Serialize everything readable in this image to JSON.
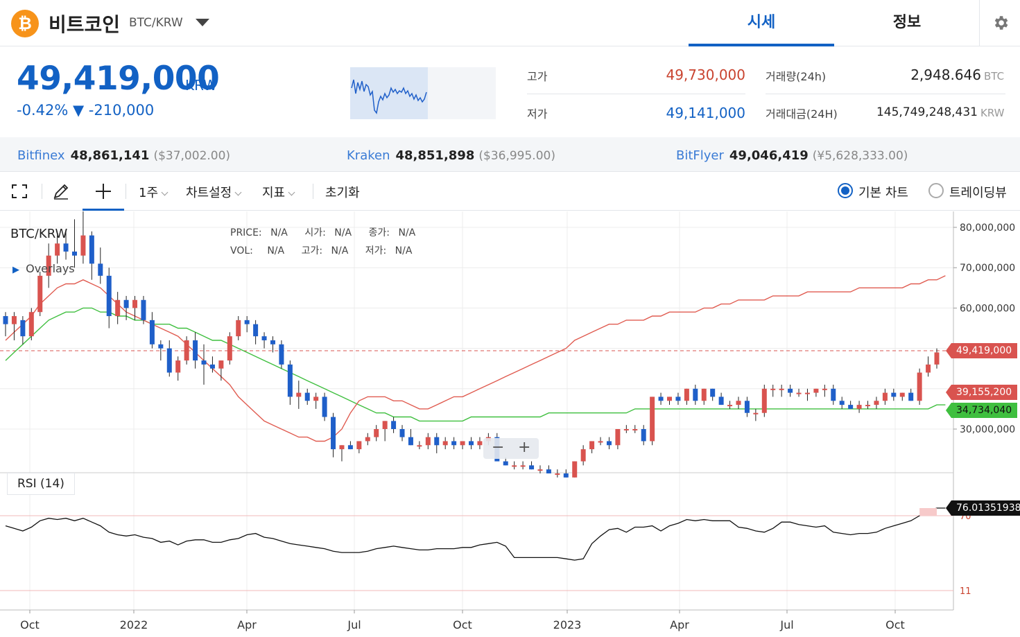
{
  "header": {
    "coin_icon_glyph": "₿",
    "coin_name": "비트코인",
    "pair": "BTC/KRW",
    "tabs": [
      {
        "label": "시세",
        "active": true
      },
      {
        "label": "정보",
        "active": false
      }
    ]
  },
  "summary": {
    "price": "49,419,000",
    "unit": "KRW",
    "change": "-0.42% ▼ -210,000",
    "high_label": "고가",
    "high_value": "49,730,000",
    "low_label": "저가",
    "low_value": "49,141,000",
    "volume_label": "거래량(24h)",
    "volume_value": "2,948.646",
    "volume_unit": "BTC",
    "amount_label": "거래대금(24H)",
    "amount_value": "145,749,248,431",
    "amount_unit": "KRW"
  },
  "exchanges": [
    {
      "name": "Bitfinex",
      "price": "48,861,141",
      "fx": "($37,002.00)"
    },
    {
      "name": "Kraken",
      "price": "48,851,898",
      "fx": "($36,995.00)"
    },
    {
      "name": "BitFlyer",
      "price": "49,046,419",
      "fx": "(¥5,628,333.00)"
    }
  ],
  "toolbar": {
    "interval": "1주",
    "chart_settings": "차트설정",
    "indicators": "지표",
    "reset": "초기화",
    "basic_chart": "기본 차트",
    "tradingview": "트레이딩뷰"
  },
  "chart": {
    "symbol": "BTC/KRW",
    "overlays": "Overlays",
    "info_labels": [
      "PRICE:",
      "N/A",
      "시가:",
      "N/A",
      "종가:",
      "N/A",
      "VOL:",
      "N/A",
      "고가:",
      "N/A",
      "저가:",
      "N/A"
    ],
    "y_ticks": [
      "80,000,000",
      "70,000,000",
      "60,000,000",
      "30,000,000"
    ],
    "x_ticks": [
      "Oct",
      "2022",
      "Apr",
      "Jul",
      "Oct",
      "2023",
      "Apr",
      "Jul",
      "Oct"
    ],
    "tags": {
      "last": "49,419,000",
      "ma1": "39,155,200",
      "ma2": "34,734,040",
      "rsi": "76.01351938"
    },
    "zoom_minus": "−",
    "zoom_plus": "+",
    "rsi_label": "RSI (14)",
    "rsi_upper": "70",
    "rsi_lower": "11",
    "colors": {
      "up": "#d9534f",
      "down": "#1f5fc9",
      "ma_short": "#e05b50",
      "ma_long": "#3fbf3f",
      "rsi": "#111111"
    }
  },
  "chart_data": {
    "type": "candlestick",
    "symbol": "BTC/KRW",
    "interval": "1주",
    "candles_ohlc_millions": [
      [
        58,
        59,
        53,
        56
      ],
      [
        56,
        59,
        52,
        58
      ],
      [
        57,
        58,
        51,
        53
      ],
      [
        53,
        60,
        52,
        59
      ],
      [
        59,
        69,
        58,
        68
      ],
      [
        68,
        76,
        65,
        73
      ],
      [
        73,
        78,
        71,
        76
      ],
      [
        76,
        79,
        72,
        74
      ],
      [
        74,
        82,
        70,
        73
      ],
      [
        73,
        84,
        71,
        78
      ],
      [
        78,
        79,
        67,
        71
      ],
      [
        71,
        75,
        66,
        68
      ],
      [
        68,
        70,
        55,
        58
      ],
      [
        58,
        64,
        56,
        62
      ],
      [
        62,
        63,
        57,
        60
      ],
      [
        60,
        63,
        57,
        62
      ],
      [
        62,
        63,
        56,
        57
      ],
      [
        57,
        59,
        50,
        51
      ],
      [
        51,
        52,
        47,
        50
      ],
      [
        50,
        52,
        43,
        44
      ],
      [
        44,
        48,
        42,
        47
      ],
      [
        47,
        53,
        46,
        52
      ],
      [
        52,
        54,
        45,
        47
      ],
      [
        47,
        51,
        41,
        46
      ],
      [
        46,
        48,
        44,
        45
      ],
      [
        45,
        47,
        42,
        47
      ],
      [
        47,
        54,
        46,
        53
      ],
      [
        53,
        58,
        52,
        57
      ],
      [
        57,
        58,
        54,
        56
      ],
      [
        56,
        57,
        51,
        53
      ],
      [
        53,
        54,
        50,
        52
      ],
      [
        52,
        53,
        49,
        51
      ],
      [
        51,
        52,
        45,
        46
      ],
      [
        46,
        47,
        36,
        38
      ],
      [
        38,
        42,
        35,
        39
      ],
      [
        39,
        40,
        36,
        37
      ],
      [
        37,
        39,
        35,
        38
      ],
      [
        38,
        39,
        32,
        33
      ],
      [
        33,
        34,
        23,
        25
      ],
      [
        25,
        26,
        22,
        26
      ],
      [
        26,
        27,
        25,
        25
      ],
      [
        25,
        27,
        24,
        27
      ],
      [
        27,
        29,
        26,
        28
      ],
      [
        28,
        31,
        27,
        30
      ],
      [
        30,
        32,
        27,
        32
      ],
      [
        32,
        33,
        29,
        30
      ],
      [
        30,
        31,
        27,
        28
      ],
      [
        28,
        30,
        26,
        26
      ],
      [
        26,
        27,
        25,
        26
      ],
      [
        26,
        29,
        25,
        28
      ],
      [
        28,
        29,
        24,
        26
      ],
      [
        26,
        28,
        25,
        27
      ],
      [
        27,
        28,
        25,
        26
      ],
      [
        26,
        27,
        25,
        27
      ],
      [
        27,
        28,
        25,
        26
      ],
      [
        26,
        28,
        25,
        27
      ],
      [
        27,
        29,
        26,
        28
      ],
      [
        28,
        29,
        24,
        22
      ],
      [
        22,
        23,
        21,
        21
      ],
      [
        21,
        22,
        20,
        21
      ],
      [
        21,
        22,
        20,
        21
      ],
      [
        21,
        22,
        20,
        20
      ],
      [
        20,
        21,
        19,
        20
      ],
      [
        20,
        21,
        19,
        19
      ],
      [
        19,
        20,
        18,
        19
      ],
      [
        19,
        20,
        18,
        18
      ],
      [
        18,
        22,
        18,
        22
      ],
      [
        22,
        26,
        21,
        25
      ],
      [
        25,
        27,
        24,
        27
      ],
      [
        27,
        28,
        26,
        27
      ],
      [
        27,
        28,
        25,
        26
      ],
      [
        26,
        30,
        25,
        30
      ],
      [
        30,
        31,
        29,
        30
      ],
      [
        30,
        31,
        29,
        30
      ],
      [
        30,
        31,
        26,
        27
      ],
      [
        27,
        38,
        26,
        38
      ],
      [
        38,
        39,
        36,
        37
      ],
      [
        37,
        38,
        36,
        38
      ],
      [
        38,
        39,
        36,
        37
      ],
      [
        37,
        40,
        36,
        40
      ],
      [
        40,
        41,
        36,
        37
      ],
      [
        37,
        40,
        36,
        40
      ],
      [
        40,
        40,
        37,
        38
      ],
      [
        38,
        39,
        36,
        36
      ],
      [
        36,
        37,
        35,
        36
      ],
      [
        36,
        38,
        35,
        37
      ],
      [
        37,
        38,
        33,
        34
      ],
      [
        34,
        35,
        32,
        34
      ],
      [
        34,
        41,
        33,
        40
      ],
      [
        40,
        41,
        38,
        40
      ],
      [
        40,
        41,
        38,
        40
      ],
      [
        40,
        41,
        38,
        39
      ],
      [
        39,
        40,
        38,
        39
      ],
      [
        39,
        40,
        37,
        39
      ],
      [
        39,
        40,
        38,
        40
      ],
      [
        40,
        41,
        38,
        40
      ],
      [
        40,
        41,
        36,
        37
      ],
      [
        37,
        38,
        35,
        36
      ],
      [
        36,
        37,
        35,
        35
      ],
      [
        35,
        37,
        34,
        36
      ],
      [
        36,
        37,
        35,
        36
      ],
      [
        36,
        38,
        35,
        37
      ],
      [
        37,
        40,
        36,
        39
      ],
      [
        39,
        40,
        37,
        38
      ],
      [
        38,
        39,
        37,
        39
      ],
      [
        39,
        40,
        37,
        37
      ],
      [
        37,
        45,
        36,
        44
      ],
      [
        44,
        48,
        43,
        46
      ],
      [
        46,
        50,
        45,
        49
      ]
    ],
    "ma_short_millions": [
      52,
      54,
      56,
      58,
      61,
      63,
      65,
      66,
      66,
      67,
      66,
      65,
      63,
      61,
      59,
      58,
      57,
      56,
      55,
      54,
      53,
      51,
      49,
      47,
      45,
      43,
      41,
      38,
      36,
      34,
      32,
      31,
      30,
      29,
      28,
      28,
      27,
      27,
      28,
      30,
      34,
      37,
      38,
      38,
      38,
      37,
      37,
      36,
      35,
      35,
      36,
      37,
      38,
      38,
      39,
      40,
      41,
      42,
      43,
      44,
      45,
      46,
      47,
      48,
      49,
      50,
      52,
      53,
      54,
      55,
      56,
      56,
      57,
      57,
      57,
      58,
      58,
      59,
      59,
      59,
      59,
      60,
      60,
      61,
      61,
      62,
      62,
      62,
      62,
      63,
      63,
      63,
      63,
      64,
      64,
      64,
      64,
      64,
      64,
      65,
      65,
      65,
      65,
      65,
      65,
      66,
      66,
      67,
      67,
      68
    ],
    "ma_long_millions": [
      47,
      49,
      51,
      53,
      55,
      57,
      58,
      59,
      59,
      60,
      60,
      59,
      59,
      58,
      58,
      57,
      57,
      56,
      56,
      56,
      55,
      55,
      54,
      53,
      52,
      52,
      51,
      50,
      49,
      48,
      47,
      46,
      45,
      44,
      43,
      42,
      41,
      40,
      39,
      38,
      37,
      36,
      35,
      34,
      34,
      33,
      33,
      33,
      32,
      32,
      32,
      32,
      32,
      32,
      33,
      33,
      33,
      33,
      33,
      33,
      33,
      33,
      33,
      34,
      34,
      34,
      34,
      34,
      34,
      34,
      34,
      34,
      34,
      35,
      35,
      35,
      35,
      35,
      35,
      35,
      35,
      35,
      35,
      35,
      35,
      35,
      35,
      35,
      35,
      35,
      35,
      35,
      35,
      35,
      35,
      35,
      35,
      35,
      35,
      35,
      35,
      35,
      35,
      35,
      35,
      35,
      35,
      35,
      36,
      36
    ],
    "rsi": [
      62,
      60,
      58,
      61,
      66,
      68,
      67,
      68,
      66,
      68,
      65,
      62,
      57,
      55,
      54,
      55,
      53,
      52,
      49,
      50,
      47,
      50,
      51,
      51,
      49,
      49,
      51,
      52,
      55,
      56,
      53,
      52,
      50,
      48,
      47,
      46,
      45,
      44,
      42,
      41,
      41,
      41,
      42,
      44,
      45,
      46,
      45,
      44,
      43,
      43,
      44,
      44,
      44,
      45,
      45,
      47,
      48,
      49,
      46,
      37,
      37,
      37,
      37,
      37,
      37,
      36,
      35,
      36,
      48,
      54,
      59,
      60,
      57,
      61,
      61,
      62,
      58,
      62,
      64,
      67,
      66,
      67,
      66,
      66,
      66,
      61,
      60,
      58,
      57,
      60,
      65,
      65,
      63,
      62,
      61,
      62,
      57,
      56,
      55,
      56,
      56,
      57,
      60,
      62,
      64,
      66,
      70,
      74,
      76,
      76
    ],
    "last_price": 49419000,
    "ma1_last": 39155200,
    "ma2_last": 34734040,
    "rsi_last": 76.01351938
  }
}
